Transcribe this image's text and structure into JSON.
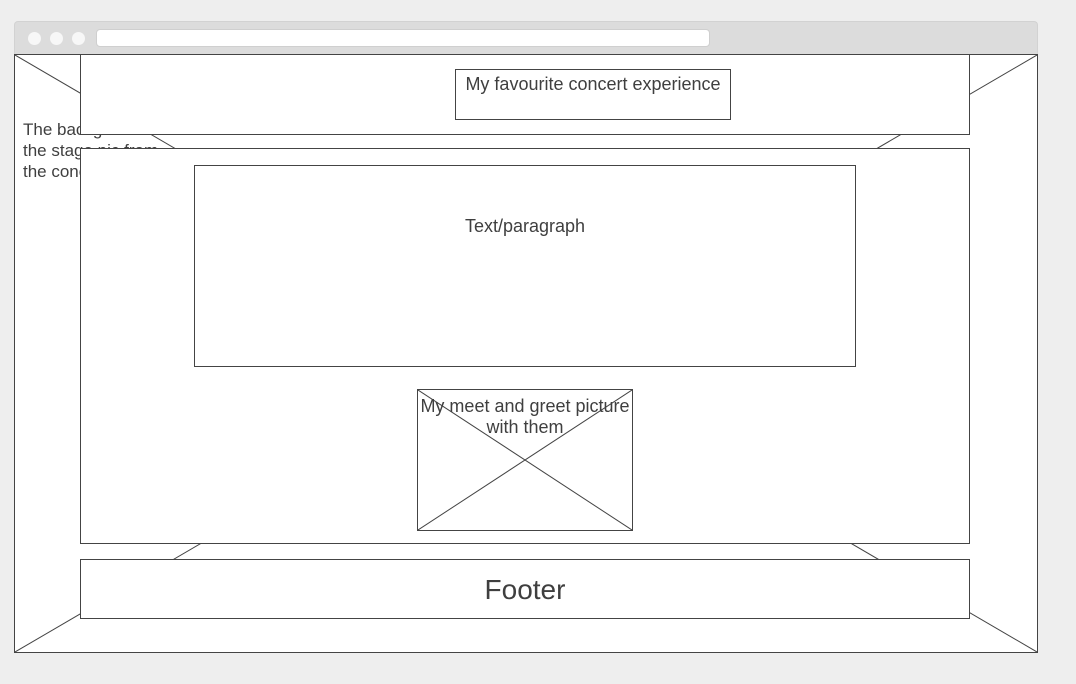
{
  "browser": {
    "url": ""
  },
  "header": {
    "title": "My favourite concert experience"
  },
  "background_note": {
    "text": "The background is the stage pic from the concert"
  },
  "main": {
    "paragraph_label": "Text/paragraph",
    "image_label": "My meet and greet picture with them"
  },
  "footer": {
    "label": "Footer"
  },
  "icons": {
    "window_dots": [
      "window-dot-icon",
      "window-dot-icon",
      "window-dot-icon"
    ],
    "image_placeholder": "image-placeholder-icon"
  },
  "colors": {
    "stroke": "#444444",
    "text": "#3f3f3f",
    "chrome": "#dcdcdc",
    "page_bg": "#eeeeee"
  }
}
